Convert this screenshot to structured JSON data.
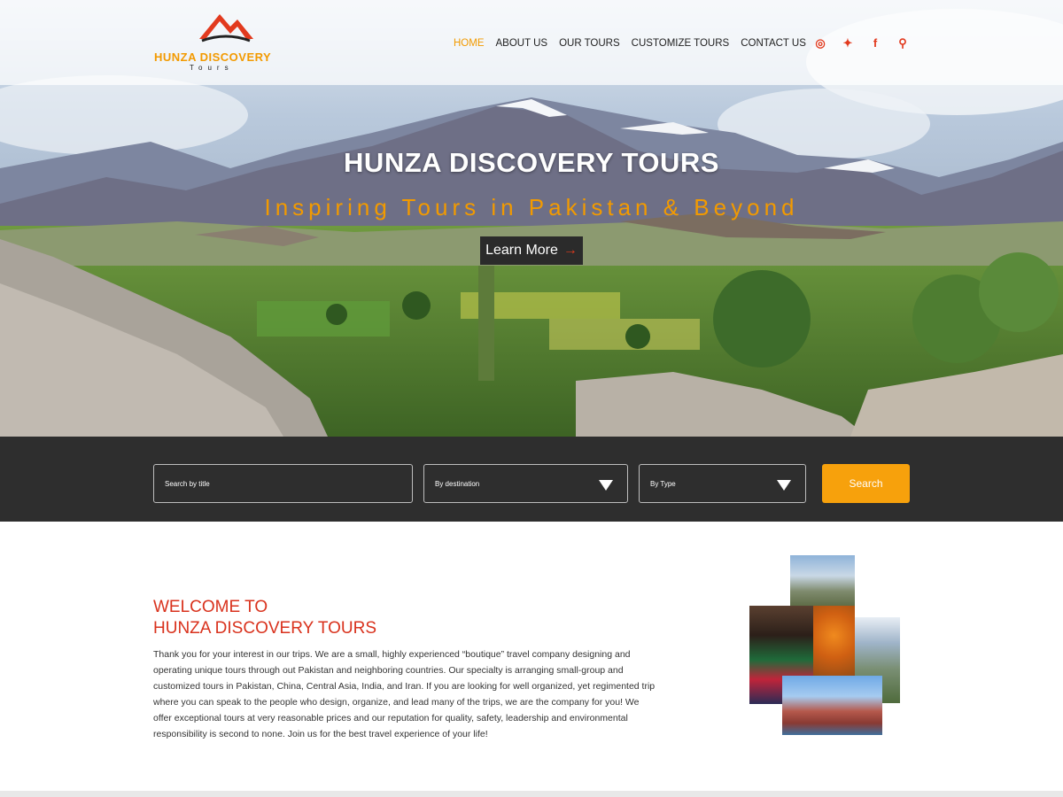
{
  "header": {
    "logo": {
      "brand": "HUNZA DISCOVERY",
      "sub": "Tours"
    },
    "nav": [
      {
        "label": "HOME",
        "active": true
      },
      {
        "label": "ABOUT US",
        "active": false
      },
      {
        "label": "OUR TOURS",
        "active": false
      },
      {
        "label": "CUSTOMIZE TOURS",
        "active": false
      },
      {
        "label": "CONTACT US",
        "active": false
      }
    ],
    "social": [
      {
        "icon": "instagram-icon",
        "glyph": "◎"
      },
      {
        "icon": "twitter-icon",
        "glyph": "✦"
      },
      {
        "icon": "facebook-icon",
        "glyph": "f"
      },
      {
        "icon": "search-icon",
        "glyph": "⚲"
      }
    ]
  },
  "hero": {
    "title": "HUNZA DISCOVERY TOURS",
    "subtitle": "Inspiring Tours in Pakistan & Beyond",
    "button": "Learn More",
    "button_icon": "arrow-right-icon"
  },
  "search": {
    "title_placeholder": "Search by title",
    "destination_placeholder": "By destination",
    "type_placeholder": "By Type",
    "button": "Search"
  },
  "welcome": {
    "heading_line1": "WELCOME TO",
    "heading_line2": "HUNZA DISCOVERY TOURS",
    "body": "Thank you for your interest in our trips. We are a small, highly experienced “boutique” travel company designing and operating unique tours through out Pakistan and neighboring countries. Our specialty is arranging small-group and customized tours in Pakistan, China, Central Asia, India,  and Iran. If you are looking for well organized, yet regimented trip where you can speak to the people who design, organize, and lead many of the trips, we are the company for you! We offer exceptional tours at very reasonable prices and our reputation for quality, safety, leadership and environmental responsibility is second to none. Join us for the best travel experience of your life!"
  },
  "colors": {
    "accent": "#f29a00",
    "heading_red": "#d9321d",
    "search_bg": "#2e2e2e",
    "search_button": "#f7a10c"
  }
}
